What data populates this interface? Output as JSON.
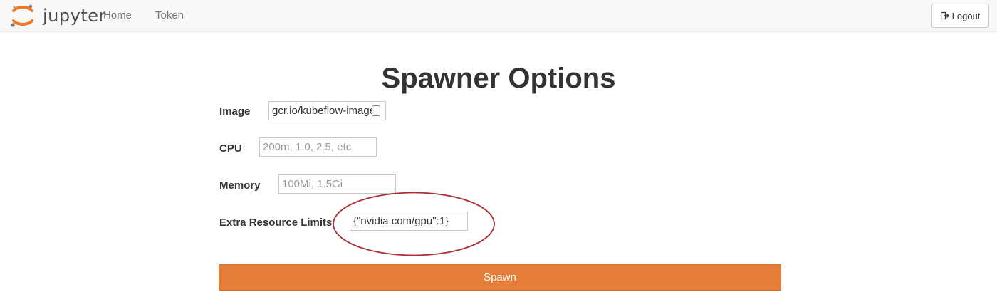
{
  "navbar": {
    "brand": "jupyter",
    "links": [
      {
        "label": "Home"
      },
      {
        "label": "Token"
      }
    ],
    "logout_label": "Logout"
  },
  "page_title": "Spawner Options",
  "form": {
    "image": {
      "label": "Image",
      "value": "gcr.io/kubeflow-image",
      "placeholder": ""
    },
    "cpu": {
      "label": "CPU",
      "value": "",
      "placeholder": "200m, 1.0, 2.5, etc"
    },
    "memory": {
      "label": "Memory",
      "value": "",
      "placeholder": "100Mi, 1.5Gi"
    },
    "extra_resource_limits": {
      "label": "Extra Resource Limits",
      "value": "{\"nvidia.com/gpu\":1}",
      "placeholder": ""
    },
    "submit_label": "Spawn"
  },
  "colors": {
    "brand_orange": "#e47d38",
    "annotation_circle": "#a83030",
    "navbar_bg": "#f8f8f8"
  },
  "icons": [
    "jupyter-logo-icon",
    "logout-icon",
    "dropdown-spin-icon"
  ]
}
